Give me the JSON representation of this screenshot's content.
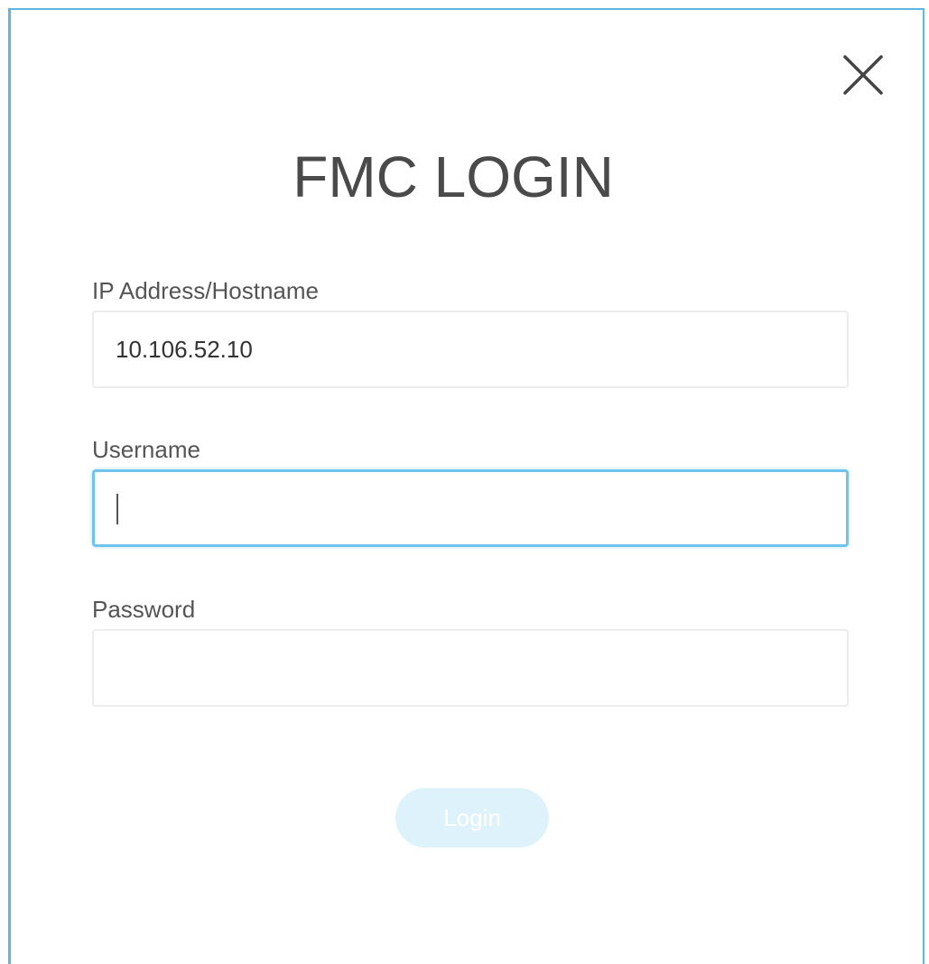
{
  "dialog": {
    "title": "FMC LOGIN",
    "close_icon": "close-icon"
  },
  "fields": {
    "ip": {
      "label": "IP Address/Hostname",
      "value": "10.106.52.10",
      "placeholder": ""
    },
    "username": {
      "label": "Username",
      "value": "",
      "placeholder": ""
    },
    "password": {
      "label": "Password",
      "value": "",
      "placeholder": ""
    }
  },
  "actions": {
    "login_label": "Login"
  },
  "colors": {
    "accent": "#5bb8e0",
    "focus": "#6ec4ea",
    "button_disabled_bg": "#def2fb"
  }
}
